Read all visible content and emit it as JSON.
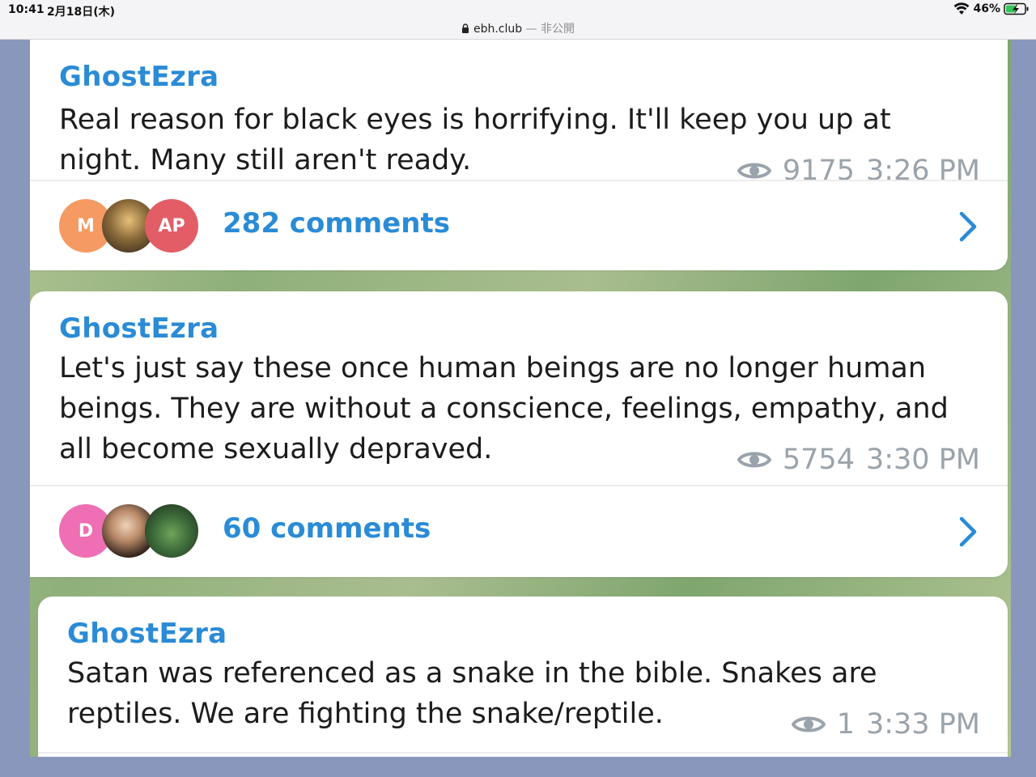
{
  "status_bar": {
    "time": "10:41",
    "date": "2月18日(木)",
    "url": "ebh.club",
    "url_suffix": " — 非公開",
    "battery": "46%"
  },
  "messages": [
    {
      "author": "GhostEzra",
      "text": "Real reason for black eyes is horrifying. It'll keep you up at night. Many still aren't ready.",
      "views": "9175",
      "time": "3:26 PM",
      "comments": "282 comments",
      "avatars": [
        {
          "initials": "M",
          "color": "#f59a62"
        },
        {
          "initials": "",
          "color": "#4b3b2a"
        },
        {
          "initials": "AP",
          "color": "#e35d66"
        }
      ]
    },
    {
      "author": "GhostEzra",
      "text": "Let's just say these once human beings are no longer human beings. They are without a conscience, feelings, empathy, and all become sexually depraved.",
      "views": "5754",
      "time": "3:30 PM",
      "comments": "60 comments",
      "avatars": [
        {
          "initials": "D",
          "color": "#ee6fb3"
        },
        {
          "initials": "",
          "color": "#5a4634"
        },
        {
          "initials": "",
          "color": "#3d6b3a"
        }
      ]
    },
    {
      "author": "GhostEzra",
      "text": "Satan was referenced as a snake in the bible. Snakes are reptiles. We are fighting the snake/reptile.",
      "views": "1",
      "time": "3:33 PM"
    }
  ],
  "colors": {
    "accent": "#2a8bd6",
    "meta": "#9aa3ab",
    "frame": "#8a97bc"
  }
}
